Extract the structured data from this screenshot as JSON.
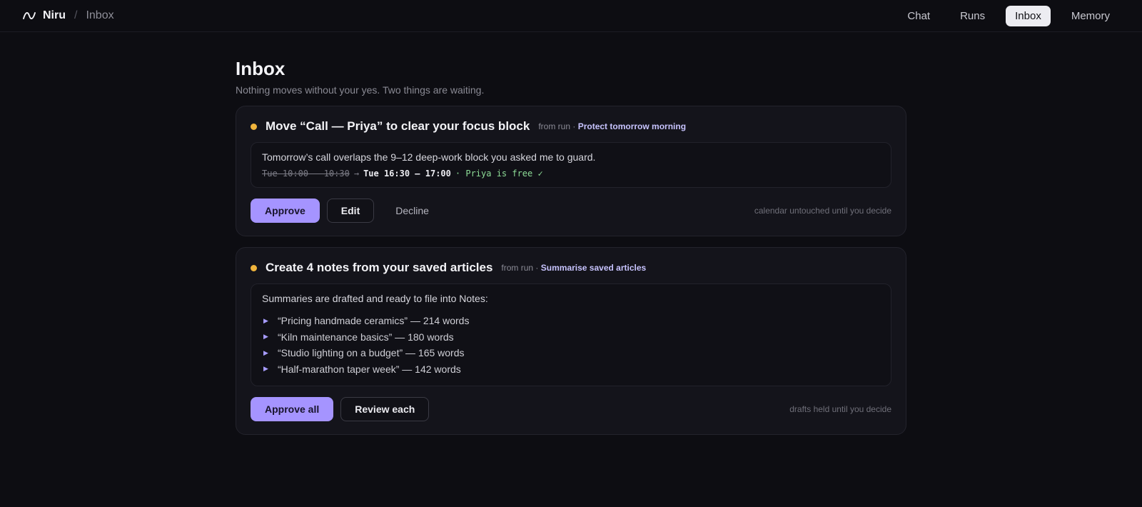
{
  "header": {
    "brand": "Niru",
    "separator": "/",
    "crumb": "Inbox",
    "nav": [
      {
        "label": "Chat",
        "active": false
      },
      {
        "label": "Runs",
        "active": false
      },
      {
        "label": "Inbox",
        "active": true
      },
      {
        "label": "Memory",
        "active": false
      }
    ]
  },
  "page": {
    "title": "Inbox",
    "subtitle": "Nothing moves without your yes. Two things are waiting."
  },
  "cards": [
    {
      "title": "Move “Call — Priya” to clear your focus block",
      "from_prefix": "from run · ",
      "from_link": "Protect tomorrow morning",
      "lead": "Tomorrow’s call overlaps the 9–12 deep-work block you asked me to guard.",
      "old_time": "Tue 10:00 – 10:30",
      "arrow": "→",
      "new_time": "Tue 16:30 – 17:00",
      "free_note": "· Priya is free ✓",
      "actions": {
        "approve": "Approve",
        "edit": "Edit",
        "decline": "Decline"
      },
      "hint": "calendar untouched until you decide"
    },
    {
      "title": "Create 4 notes from your saved articles",
      "from_prefix": "from run · ",
      "from_link": "Summarise saved articles",
      "lead": "Summaries are drafted and ready to file into Notes:",
      "notes": [
        "“Pricing handmade ceramics” — 214 words",
        "“Kiln maintenance basics” — 180 words",
        "“Studio lighting on a budget” — 165 words",
        "“Half-marathon taper week” — 142 words"
      ],
      "actions": {
        "approve_all": "Approve all",
        "review_each": "Review each"
      },
      "hint": "drafts held until you decide"
    }
  ],
  "colors": {
    "accent": "#a594ff",
    "pending_dot": "#f0b43c",
    "free_green": "#8ddc97"
  },
  "icons": {
    "logo": "wave-logo-icon",
    "pending": "pending-dot-icon",
    "bullet": "triangle-bullet-icon"
  }
}
